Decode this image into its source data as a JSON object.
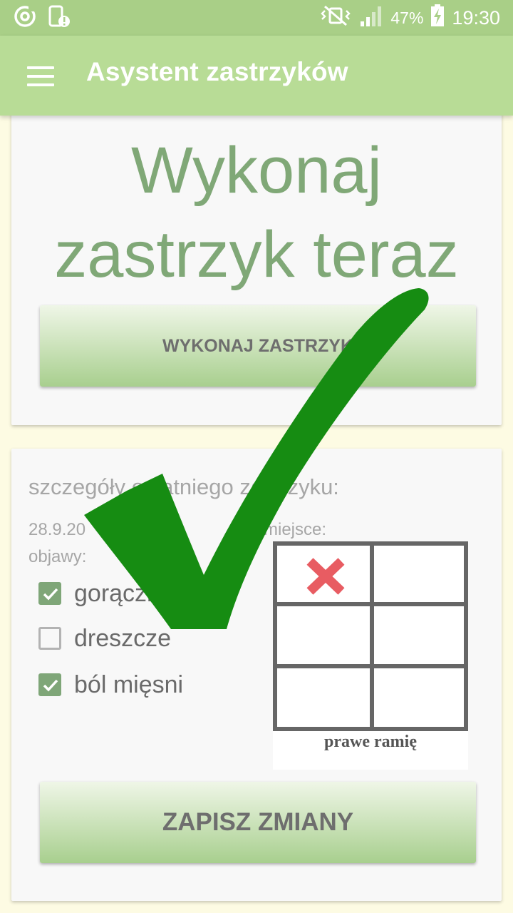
{
  "status_bar": {
    "battery_percent": "47%",
    "time": "19:30",
    "icons": [
      "sync-icon",
      "phone-alert-icon",
      "vibrate-mute-icon",
      "signal-icon",
      "battery-charging-icon"
    ]
  },
  "app_bar": {
    "title": "Asystent zastrzyków",
    "menu_icon": "hamburger-menu-icon"
  },
  "main_card": {
    "headline": "Wykonaj zastrzyk teraz",
    "inject_button": "WYKONAJ ZASTRZYK"
  },
  "details_card": {
    "title": "szczegóły ostatniego zastrzyku:",
    "date_label": "28.9.20",
    "place_label": "miejsce:",
    "symptoms_label": "objawy:",
    "symptoms": [
      {
        "label": "gorączka",
        "checked": true
      },
      {
        "label": "dreszcze",
        "checked": false
      },
      {
        "label": "ból mięsni",
        "checked": true
      }
    ],
    "injection_site": {
      "caption": "prawe ramię",
      "grid_rows": 3,
      "grid_cols": 2,
      "marked_cell": "row 1, col 1"
    },
    "save_button": "ZAPISZ ZMIANY"
  },
  "overlay": {
    "icon": "green-checkmark-icon",
    "color": "#168c12"
  },
  "colors": {
    "status_bar": "#a9cf87",
    "app_bar": "#b8dc96",
    "accent_text": "#80a877",
    "mark_x": "#e85c62"
  }
}
